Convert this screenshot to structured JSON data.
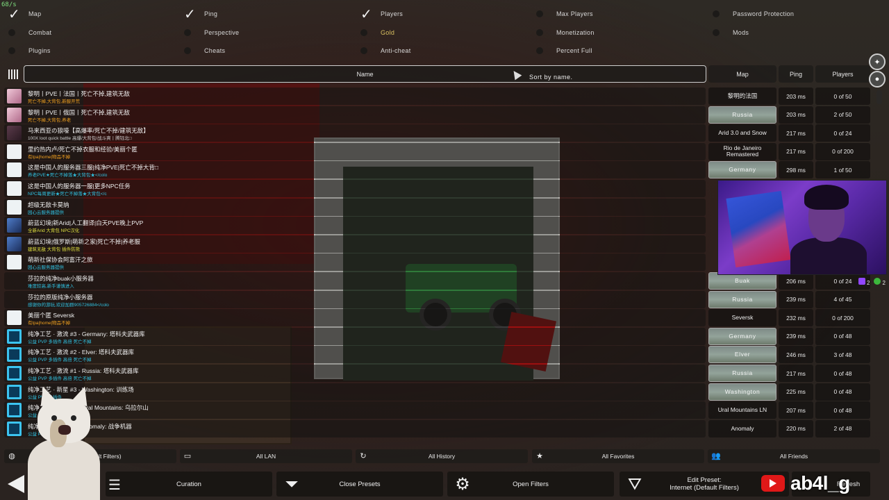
{
  "fps": "68/s",
  "filters": [
    {
      "label": "Map",
      "checked": true
    },
    {
      "label": "Ping",
      "checked": true
    },
    {
      "label": "Players",
      "checked": true
    },
    {
      "label": "Max Players",
      "checked": false
    },
    {
      "label": "Password Protection",
      "checked": false
    },
    {
      "label": "Combat",
      "checked": false
    },
    {
      "label": "Perspective",
      "checked": false
    },
    {
      "label": "Gold",
      "checked": false
    },
    {
      "label": "Monetization",
      "checked": false
    },
    {
      "label": "Mods",
      "checked": false
    },
    {
      "label": "Plugins",
      "checked": false
    },
    {
      "label": "Cheats",
      "checked": false
    },
    {
      "label": "Anti-cheat",
      "checked": false
    },
    {
      "label": "Percent Full",
      "checked": false
    }
  ],
  "header": {
    "name": "Name",
    "map": "Map",
    "ping": "Ping",
    "players": "Players",
    "tooltip": "Sort by name."
  },
  "servers": [
    {
      "name": "黎明丨PVE丨法国丨死亡不掉,建筑无敌",
      "desc": "死亡不掉,大背包,新服开荒",
      "descColor": "#f0a020",
      "icon": "ic-pink",
      "map": "黎明的法国",
      "mapImg": false,
      "ping": "203 ms",
      "players": "0 of 50"
    },
    {
      "name": "黎明丨PVE丨俄国丨死亡不掉,建筑无敌",
      "desc": "死亡不掉,大背包,养老",
      "descColor": "#f0a020",
      "icon": "ic-pink",
      "map": "Russia",
      "mapImg": true,
      "ping": "203 ms",
      "players": "2 of 50"
    },
    {
      "name": "马来西亚の狼嚎【高爆率/死亡不掉/建筑无敌】",
      "desc": "100X loot quick battle 高爆/大背包/战斗爽丨腾钰北□",
      "descColor": "#d0d0d0",
      "icon": "ic-dark",
      "map": "Arid 3.0 and Snow",
      "mapImg": false,
      "ping": "217 ms",
      "players": "0 of 24"
    },
    {
      "name": "里约热内卢/死亡不掉衣服和经验/美丽个匿",
      "desc": "有tpa|home|物品不掉",
      "descColor": "#f0a020",
      "icon": "ic-white",
      "map": "Rio de Janeiro Remastered",
      "mapImg": false,
      "ping": "217 ms",
      "players": "0 of 200"
    },
    {
      "name": "这是中国人的服务器三服|纯净PVE|死亡不掉大背□",
      "desc": "养老PVE★死亡不掉落★大背包★</colo",
      "descColor": "#30c0e0",
      "icon": "ic-white",
      "map": "Germany",
      "mapImg": true,
      "ping": "298 ms",
      "players": "1 of 50"
    },
    {
      "name": "这是中国人的服务器一服|更多NPC任务",
      "desc": "NPC每周更新★死亡不掉落★大背包</c",
      "descColor": "#30c0e0",
      "icon": "ic-white",
      "map": "",
      "mapImg": false,
      "ping": "",
      "players": ""
    },
    {
      "name": "超级无敌卡莫纳",
      "desc": "园心云服务器提供",
      "descColor": "#30c0e0",
      "icon": "ic-white",
      "map": "",
      "mapImg": false,
      "ping": "",
      "players": ""
    },
    {
      "name": "蔚蓝幻境|新Arid|人工翻译|白天PVE晚上PVP",
      "desc": "全新Arid 大背包 NPC汉化",
      "descColor": "#e0e040",
      "icon": "ic-blue",
      "map": "",
      "mapImg": false,
      "ping": "",
      "players": ""
    },
    {
      "name": "蔚蓝幻境|俄罗斯|萌新之家|死亡不掉|养老服",
      "desc": "建筑无敌 大背包 插件防熊",
      "descColor": "#e0e040",
      "icon": "ic-blue",
      "map": "",
      "mapImg": false,
      "ping": "",
      "players": ""
    },
    {
      "name": "萌新社保协会阿富汗之旅",
      "desc": "园心云服务器提供",
      "descColor": "#30c0e0",
      "icon": "ic-white",
      "map": "",
      "mapImg": false,
      "ping": "",
      "players": ""
    },
    {
      "name": "莎拉的纯净buak小服务器",
      "desc": "难度较高,新手谨慎进入",
      "descColor": "#30c0e0",
      "icon": "ic-none",
      "map": "Buak",
      "mapImg": true,
      "ping": "206 ms",
      "players": "0 of 24"
    },
    {
      "name": "莎拉的原版纯净小服务器",
      "desc": "感谢你的游玩,欢迎加群905726884</colo",
      "descColor": "#30c0e0",
      "icon": "ic-none",
      "map": "Russia",
      "mapImg": true,
      "ping": "239 ms",
      "players": "4 of 45"
    },
    {
      "name": "美丽个匿 Seversk",
      "desc": "有tpa|home|物品不掉",
      "descColor": "#f0a020",
      "icon": "ic-white",
      "map": "Seversk",
      "mapImg": false,
      "ping": "232 ms",
      "players": "0 of 200"
    },
    {
      "name": "纯净工艺 · 激流 #3 - Germany: 塔科夫武器库",
      "desc": "公益 PVP 多插件 高倍 死亡不掉",
      "descColor": "#30c0e0",
      "icon": "ic-cyan",
      "map": "Germany",
      "mapImg": true,
      "ping": "239 ms",
      "players": "0 of 48"
    },
    {
      "name": "纯净工艺 · 激流 #2 - Elver: 塔科夫武器库",
      "desc": "公益 PVP 多插件 高倍 死亡不掉",
      "descColor": "#30c0e0",
      "icon": "ic-cyan",
      "map": "Elver",
      "mapImg": true,
      "ping": "246 ms",
      "players": "3 of 48"
    },
    {
      "name": "纯净工艺 · 激流 #1 - Russia: 塔科夫武器库",
      "desc": "公益 PVP 多插件 高倍 死亡不掉",
      "descColor": "#30c0e0",
      "icon": "ic-cyan",
      "map": "Russia",
      "mapImg": true,
      "ping": "217 ms",
      "players": "0 of 48"
    },
    {
      "name": "纯净工艺 · 新星 #3 - Washington: 训练场",
      "desc": "公益 PVP 多插件",
      "descColor": "#30c0e0",
      "icon": "ic-cyan",
      "map": "Washington",
      "mapImg": true,
      "ping": "225 ms",
      "players": "0 of 48"
    },
    {
      "name": "纯净工艺 · 新星 #2 - Ural Mountains: 乌拉尔山",
      "desc": "公益 PVP 多插件",
      "descColor": "#30c0e0",
      "icon": "ic-cyan",
      "map": "Ural Mountains LN",
      "mapImg": false,
      "ping": "207 ms",
      "players": "0 of 48"
    },
    {
      "name": "纯净工艺 · 新星 #1 - Anomaly: 战争机器",
      "desc": "公益 PVP 多插件",
      "descColor": "#30c0e0",
      "icon": "ic-cyan",
      "map": "Anomaly",
      "mapImg": false,
      "ping": "220 ms",
      "players": "2 of 48"
    }
  ],
  "tabs": [
    {
      "label": "Internet (Default Filters)",
      "icon": "globe-icon",
      "glyph": "◍"
    },
    {
      "label": "All LAN",
      "icon": "monitor-icon",
      "glyph": "▭"
    },
    {
      "label": "All History",
      "icon": "history-icon",
      "glyph": "↻"
    },
    {
      "label": "All Favorites",
      "icon": "star-icon",
      "glyph": "★"
    },
    {
      "label": "All Friends",
      "icon": "friends-icon",
      "glyph": "👥"
    }
  ],
  "actions": {
    "curation": "Curation",
    "close_presets": "Close Presets",
    "open_filters": "Open Filters",
    "edit_preset_line1": "Edit Preset:",
    "edit_preset_line2": "Internet (Default Filters)",
    "refresh": "Refresh"
  },
  "badges": {
    "twitch": "2",
    "xbox": "2"
  },
  "overlay": {
    "handle": "ab4l_g"
  }
}
